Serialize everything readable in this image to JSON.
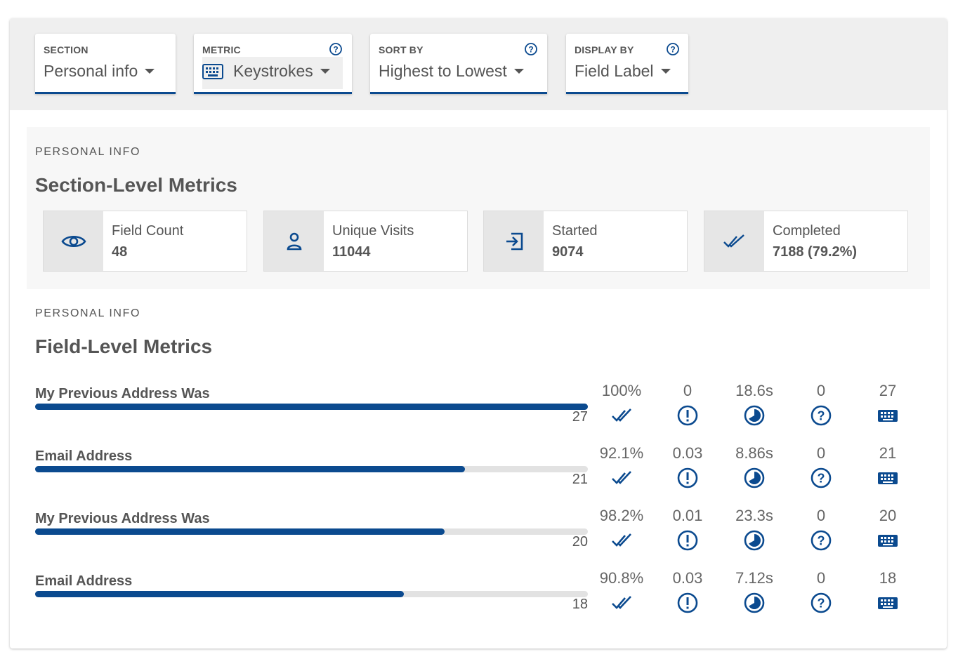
{
  "filters": {
    "section": {
      "label": "SECTION",
      "value": "Personal info"
    },
    "metric": {
      "label": "METRIC",
      "value": "Keystrokes"
    },
    "sort_by": {
      "label": "SORT BY",
      "value": "Highest to Lowest"
    },
    "display_by": {
      "label": "DISPLAY BY",
      "value": "Field Label"
    }
  },
  "section_metrics": {
    "eyebrow": "PERSONAL INFO",
    "title": "Section-Level Metrics",
    "stats": [
      {
        "icon": "eye-icon",
        "label": "Field Count",
        "value": "48"
      },
      {
        "icon": "person-icon",
        "label": "Unique Visits",
        "value": "11044"
      },
      {
        "icon": "enter-icon",
        "label": "Started",
        "value": "9074"
      },
      {
        "icon": "double-check-icon",
        "label": "Completed",
        "value": "7188 (79.2%)"
      }
    ]
  },
  "field_metrics": {
    "eyebrow": "PERSONAL INFO",
    "title": "Field-Level Metrics",
    "rows": [
      {
        "label": "My Previous Address Was",
        "count": "27",
        "bar_fraction": 1.0,
        "completion": "100%",
        "errors": "0",
        "time": "18.6s",
        "help": "0",
        "keystrokes": "27"
      },
      {
        "label": "Email Address",
        "count": "21",
        "bar_fraction": 0.778,
        "completion": "92.1%",
        "errors": "0.03",
        "time": "8.86s",
        "help": "0",
        "keystrokes": "21"
      },
      {
        "label": "My Previous Address Was",
        "count": "20",
        "bar_fraction": 0.741,
        "completion": "98.2%",
        "errors": "0.01",
        "time": "23.3s",
        "help": "0",
        "keystrokes": "20"
      },
      {
        "label": "Email Address",
        "count": "18",
        "bar_fraction": 0.667,
        "completion": "90.8%",
        "errors": "0.03",
        "time": "7.12s",
        "help": "0",
        "keystrokes": "18"
      }
    ]
  },
  "colors": {
    "accent": "#0b4a8f",
    "panel": "#f7f7f7",
    "filter_bar": "#efefef"
  }
}
